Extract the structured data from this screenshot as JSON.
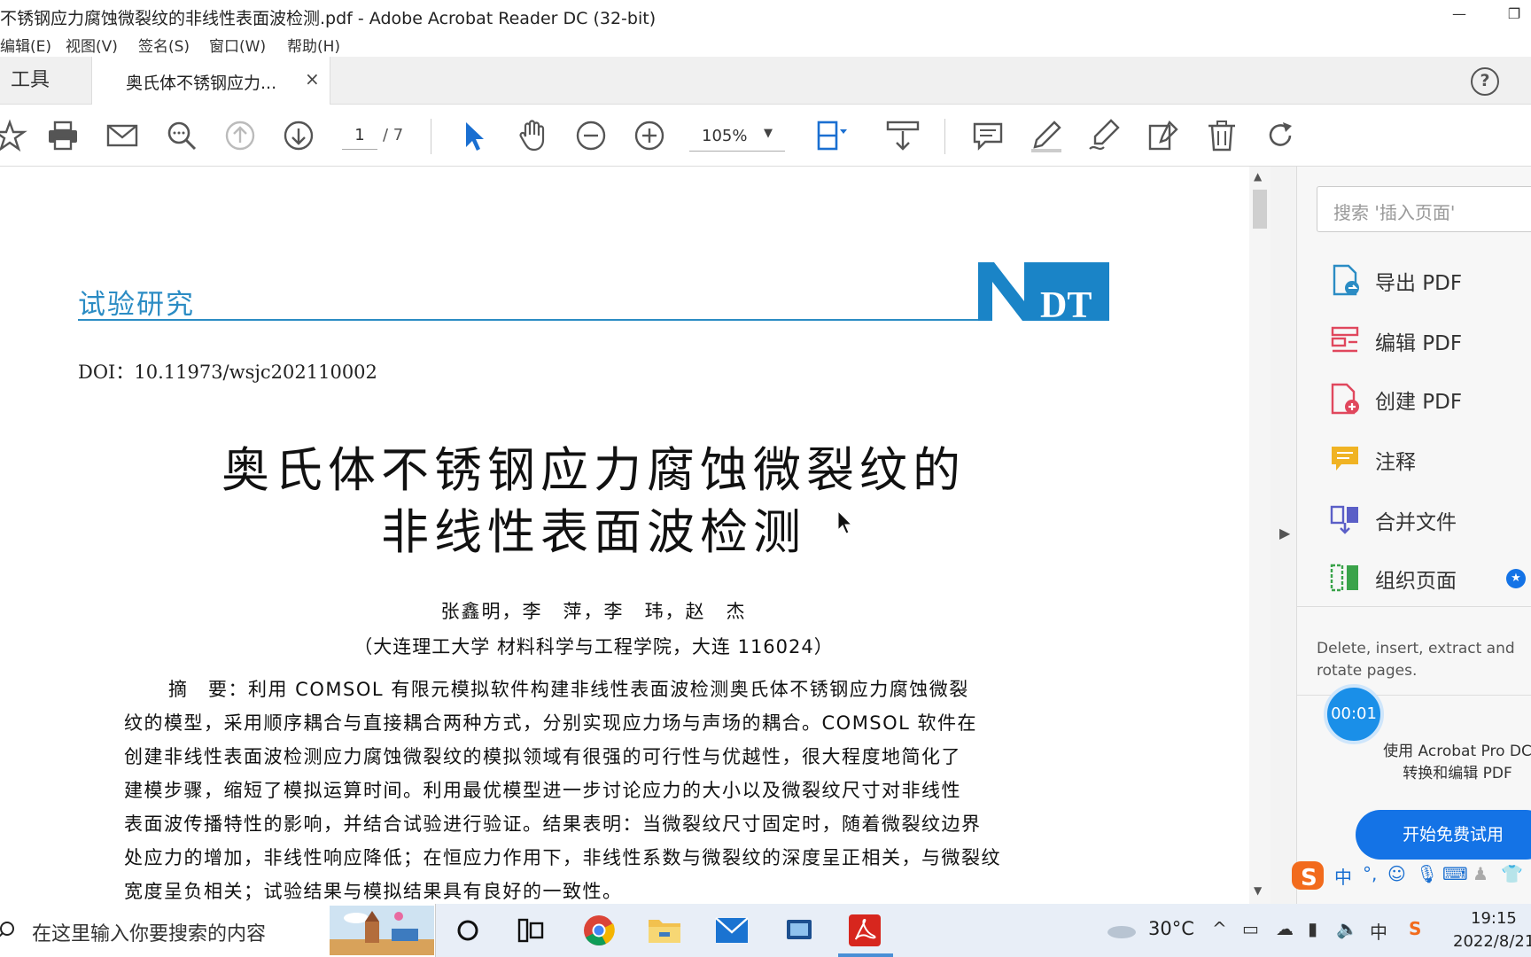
{
  "window": {
    "title": "不锈钢应力腐蚀微裂纹的非线性表面波检测.pdf - Adobe Acrobat Reader DC (32-bit)",
    "minimize": "—",
    "restore": "❐"
  },
  "menu": [
    "编辑(E)",
    "视图(V)",
    "签名(S)",
    "窗口(W)",
    "帮助(H)"
  ],
  "tabs": {
    "tools": "工具",
    "document": "奥氏体不锈钢应力...",
    "close": "×",
    "help": "?"
  },
  "toolbar": {
    "page_current": "1",
    "page_total": "/ 7",
    "zoom": "105%",
    "zoom_caret": "▼"
  },
  "document": {
    "section": "试验研究",
    "logo": "NDT",
    "doi": "DOI：10.11973/wsjc202110002",
    "title_line1": "奥氏体不锈钢应力腐蚀微裂纹的",
    "title_line2": "非线性表面波检测",
    "authors": "张鑫明，李　萍，李　玮，赵　杰",
    "affiliation": "（大连理工大学 材料科学与工程学院，大连 116024）",
    "abstract_lines": [
      "摘　要：利用 COMSOL 有限元模拟软件构建非线性表面波检测奥氏体不锈钢应力腐蚀微裂",
      "纹的模型，采用顺序耦合与直接耦合两种方式，分别实现应力场与声场的耦合。COMSOL 软件在",
      "创建非线性表面波检测应力腐蚀微裂纹的模拟领域有很强的可行性与优越性，很大程度地简化了",
      "建模步骤，缩短了模拟运算时间。利用最优模型进一步讨论应力的大小以及微裂纹尺寸对非线性",
      "表面波传播特性的影响，并结合试验进行验证。结果表明：当微裂纹尺寸固定时，随着微裂纹边界",
      "处应力的增加，非线性响应降低；在恒应力作用下，非线性系数与微裂纹的深度呈正相关，与微裂纹",
      "宽度呈负相关；试验结果与模拟结果具有良好的一致性。"
    ]
  },
  "right_panel": {
    "search_placeholder": "搜索 '插入页面'",
    "items": [
      {
        "label": "导出 PDF",
        "icon": "export-pdf-icon",
        "color": "#2b8cc4"
      },
      {
        "label": "编辑 PDF",
        "icon": "edit-pdf-icon",
        "color": "#e0475d"
      },
      {
        "label": "创建 PDF",
        "icon": "create-pdf-icon",
        "color": "#e0475d"
      },
      {
        "label": "注释",
        "icon": "comment-icon",
        "color": "#f0b323"
      },
      {
        "label": "合并文件",
        "icon": "combine-files-icon",
        "color": "#5b5fc7"
      },
      {
        "label": "组织页面",
        "icon": "organize-pages-icon",
        "color": "#3aa34a"
      }
    ],
    "description": "Delete, insert, extract and rotate pages.",
    "promo_line1": "使用 Acrobat Pro DC",
    "promo_line2": "转换和编辑 PDF",
    "trial_button": "开始免费试用",
    "timer": "00:01"
  },
  "taskbar": {
    "search_placeholder": "在这里输入你要搜索的内容",
    "temperature": "30°C",
    "time": "19:15",
    "date": "2022/8/21",
    "ime_lang": "中",
    "tray_lang": "中"
  }
}
